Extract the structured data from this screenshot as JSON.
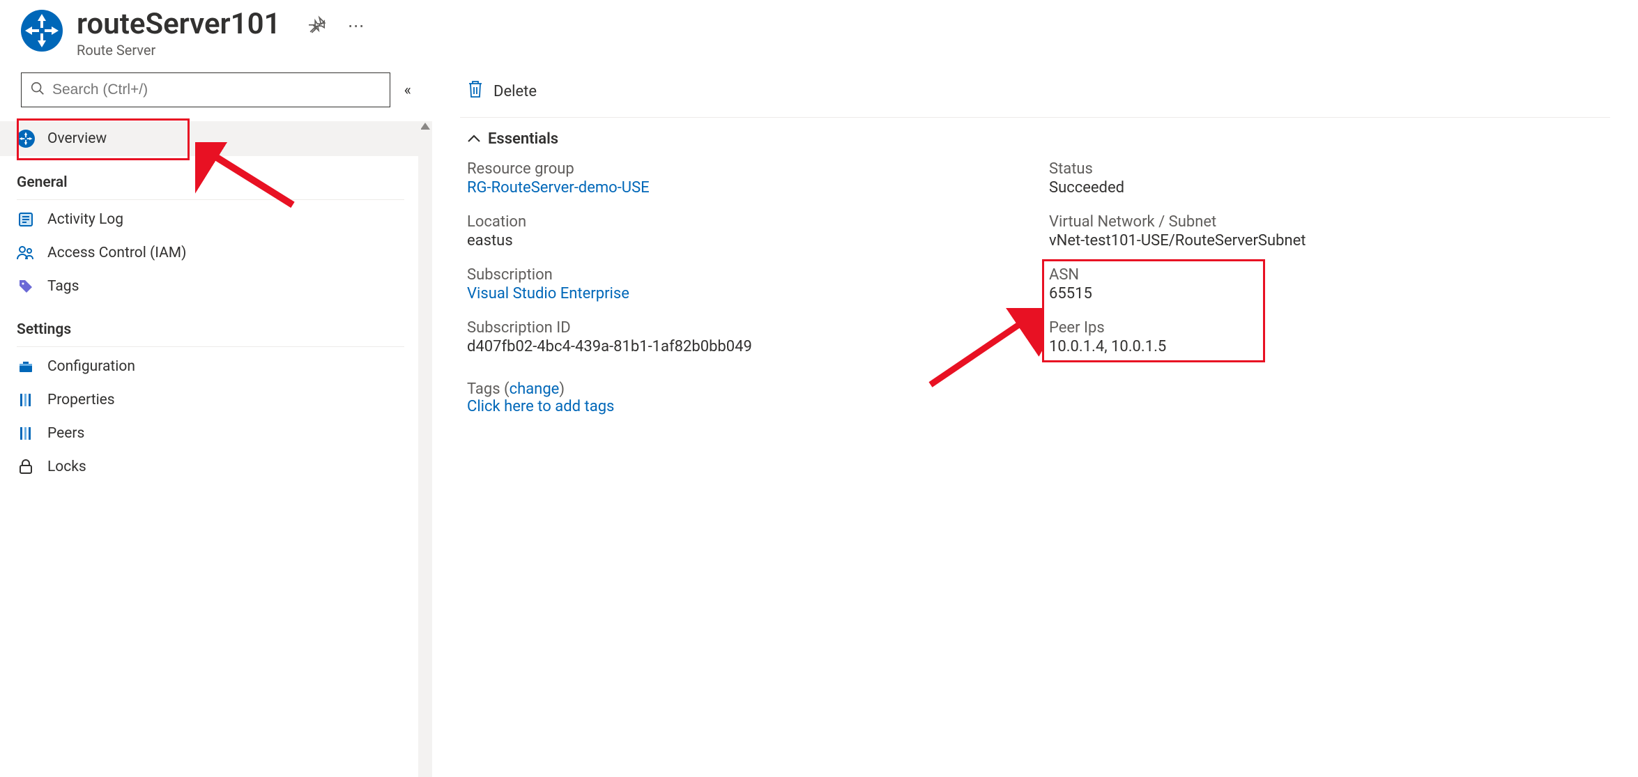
{
  "header": {
    "title": "routeServer101",
    "subtitle": "Route Server"
  },
  "sidebar": {
    "search_placeholder": "Search (Ctrl+/)",
    "overview_label": "Overview",
    "section_general": "General",
    "activity_log_label": "Activity Log",
    "access_control_label": "Access Control (IAM)",
    "tags_label": "Tags",
    "section_settings": "Settings",
    "configuration_label": "Configuration",
    "properties_label": "Properties",
    "peers_label": "Peers",
    "locks_label": "Locks"
  },
  "toolbar": {
    "delete_label": "Delete"
  },
  "essentials": {
    "header_label": "Essentials",
    "resource_group": {
      "label": "Resource group",
      "value": "RG-RouteServer-demo-USE"
    },
    "status": {
      "label": "Status",
      "value": "Succeeded"
    },
    "location": {
      "label": "Location",
      "value": "eastus"
    },
    "vnet_subnet": {
      "label": "Virtual Network / Subnet",
      "value": "vNet-test101-USE/RouteServerSubnet"
    },
    "subscription": {
      "label": "Subscription",
      "value": "Visual Studio Enterprise"
    },
    "asn": {
      "label": "ASN",
      "value": "65515"
    },
    "subscription_id": {
      "label": "Subscription ID",
      "value": "d407fb02-4bc4-439a-81b1-1af82b0bb049"
    },
    "peer_ips": {
      "label": "Peer Ips",
      "value": "10.0.1.4, 10.0.1.5"
    },
    "tags_prefix": "Tags (",
    "tags_change": "change",
    "tags_suffix": ")",
    "tags_add_link": "Click here to add tags"
  }
}
